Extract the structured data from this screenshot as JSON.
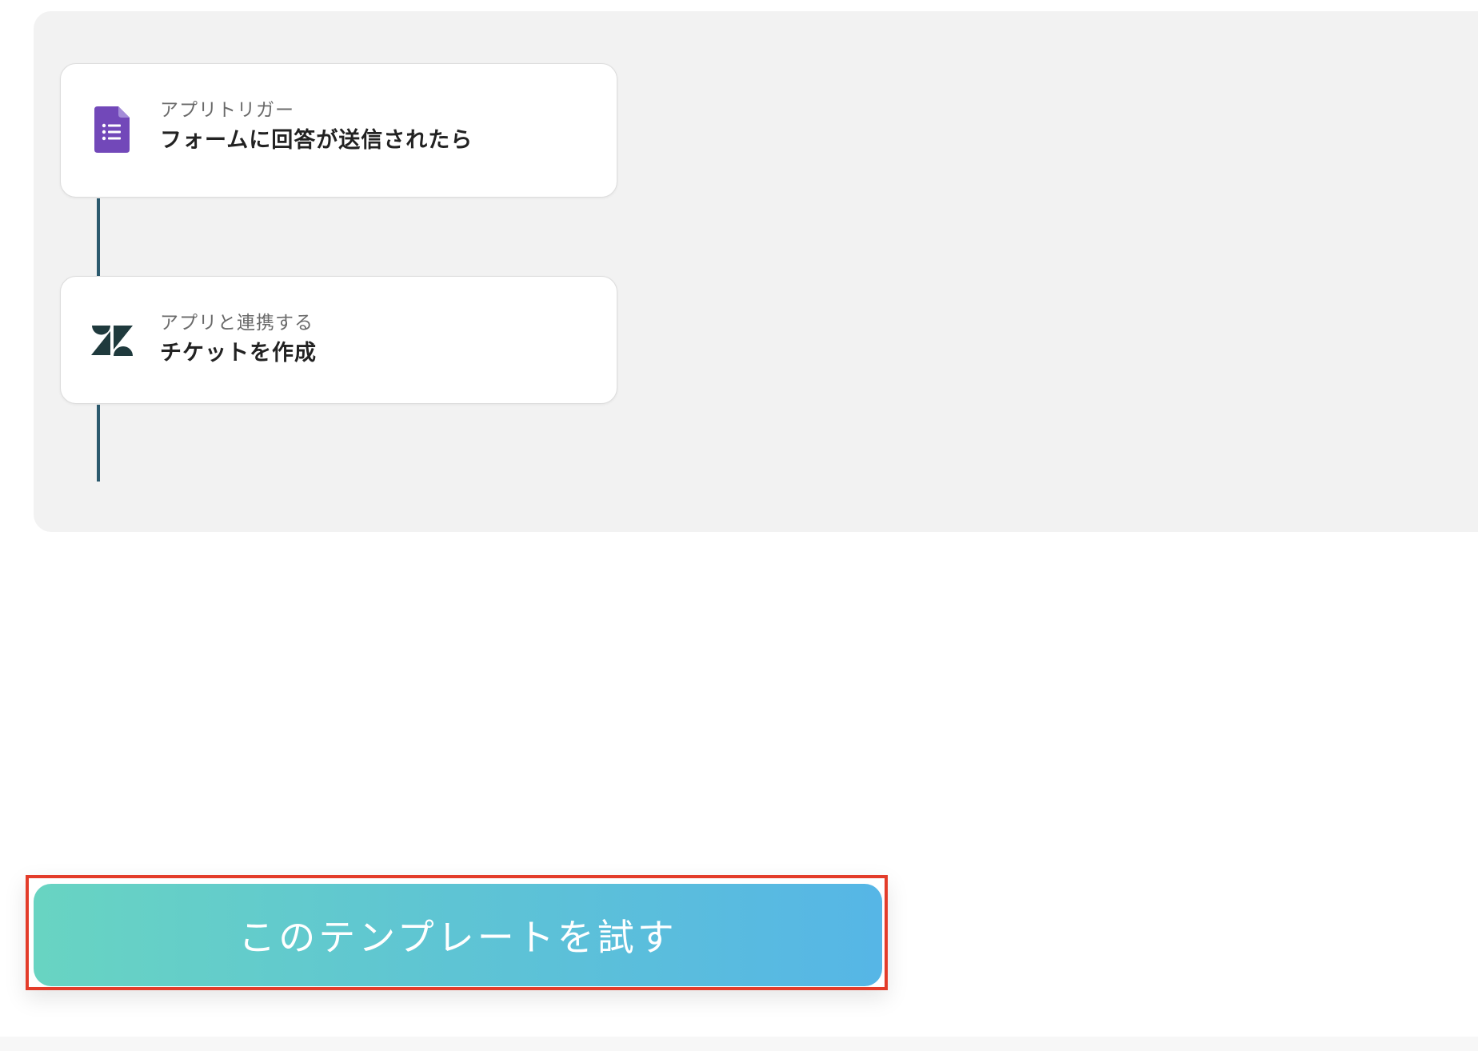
{
  "flow": {
    "steps": [
      {
        "kind": "アプリトリガー",
        "title": "フォームに回答が送信されたら",
        "icon": "google-forms-icon"
      },
      {
        "kind": "アプリと連携する",
        "title": "チケットを作成",
        "icon": "zendesk-icon"
      }
    ]
  },
  "cta": {
    "label": "このテンプレートを試す"
  },
  "colors": {
    "panel_bg": "#f2f2f2",
    "connector": "#2c5a6e",
    "forms_purple": "#7248b9",
    "zendesk_dark": "#1f3a3d",
    "cta_gradient_start": "#68d4c2",
    "cta_gradient_end": "#56b6e6",
    "highlight_red": "#e33c2a"
  }
}
